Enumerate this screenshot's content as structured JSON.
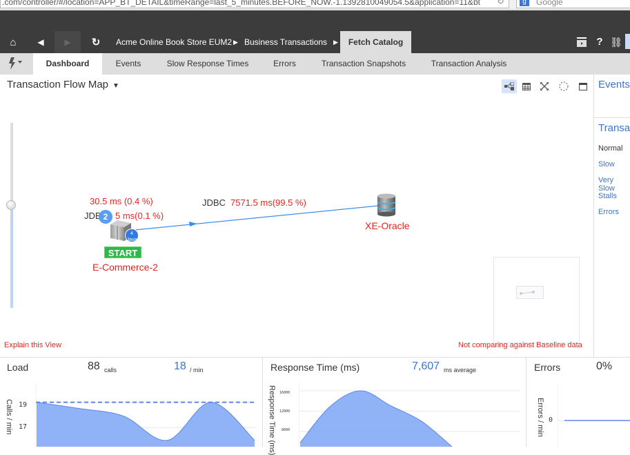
{
  "browser": {
    "url": ".com/controller/#/location=APP_BT_DETAIL&timeRange=last_5_minutes.BEFORE_NOW.-1.1392810049054.5&application=11&bt",
    "search_placeholder": "Google",
    "search_engine_icon": "g"
  },
  "topnav": {
    "home_icon": "⌂",
    "back_icon": "◀",
    "forward_icon": "▶",
    "refresh_icon": "↻",
    "breadcrumbs": [
      "Acme Online Book Store EUM2",
      "Business Transactions",
      "Fetch Catalog"
    ],
    "sep_icon": "▶",
    "right_icons": {
      "panel": "▭",
      "help": "?",
      "link": "⛓"
    }
  },
  "tabs": {
    "flow_icon": "⚡▾",
    "items": [
      {
        "label": "Dashboard",
        "active": true
      },
      {
        "label": "Events",
        "active": false
      },
      {
        "label": "Slow Response Times",
        "active": false
      },
      {
        "label": "Errors",
        "active": false
      },
      {
        "label": "Transaction Snapshots",
        "active": false
      },
      {
        "label": "Transaction Analysis",
        "active": false
      }
    ]
  },
  "flowmap": {
    "title": "Transaction Flow Map",
    "caret": "▼",
    "toolbar": [
      "flow-view",
      "grid-view",
      "fit-to-screen",
      "auto-arrange",
      "maximize"
    ],
    "zoom_level": 0.55,
    "source_node": {
      "name": "E-Commerce-2",
      "start_label": "START",
      "time_label": "30.5 ms (0.4 %)",
      "jdbc_prefix": "JDB",
      "jdbc_time": "5 ms(0.1 %)",
      "instances": "2",
      "badge_text": "Java",
      "badge_num": "4"
    },
    "edge": {
      "protocol": "JDBC",
      "time": "7571.5 ms(99.5 %)"
    },
    "target_node": {
      "name": "XE-Oracle"
    },
    "explain_link": "Explain this View",
    "baseline_note": "Not comparing against Baseline data"
  },
  "sidebar": {
    "events_title": "Events",
    "transactions_title": "Transa",
    "items": [
      "Normal",
      "Slow",
      "Very Slow",
      "Stalls",
      "Errors"
    ]
  },
  "load": {
    "title": "Load",
    "calls": "88",
    "calls_unit": "calls",
    "rate": "18",
    "rate_unit": "/ min",
    "ylabel": "Calls / min",
    "color": "#7da4f5"
  },
  "response": {
    "title": "Response Time (ms)",
    "avg": "7,607",
    "avg_unit": "ms average",
    "ylabel": "Response Time (ms)",
    "color": "#7da4f5"
  },
  "errors": {
    "title": "Errors",
    "pct": "0%",
    "ylabel": "Errors / min"
  },
  "chart_data": [
    {
      "type": "area",
      "title": "Load",
      "ylabel": "Calls / min",
      "yticks": [
        17,
        19
      ],
      "baseline": 19,
      "ylim": [
        15.5,
        20.5
      ],
      "x": [
        0,
        1,
        2,
        3,
        4,
        5
      ],
      "values": [
        19,
        18.5,
        17.9,
        16.0,
        19.0,
        16.0
      ]
    },
    {
      "type": "area",
      "title": "Response Time (ms)",
      "ylabel": "Response Time (ms)",
      "yticks": [
        8000,
        12000,
        16000
      ],
      "ylim": [
        5000,
        17500
      ],
      "x": [
        0,
        1,
        2,
        3,
        4,
        5
      ],
      "values": [
        5800,
        13000,
        16000,
        13000,
        10000,
        5000
      ]
    },
    {
      "type": "line",
      "title": "Errors",
      "ylabel": "Errors / min",
      "yticks": [
        0
      ],
      "values": [
        0,
        0,
        0
      ]
    }
  ]
}
